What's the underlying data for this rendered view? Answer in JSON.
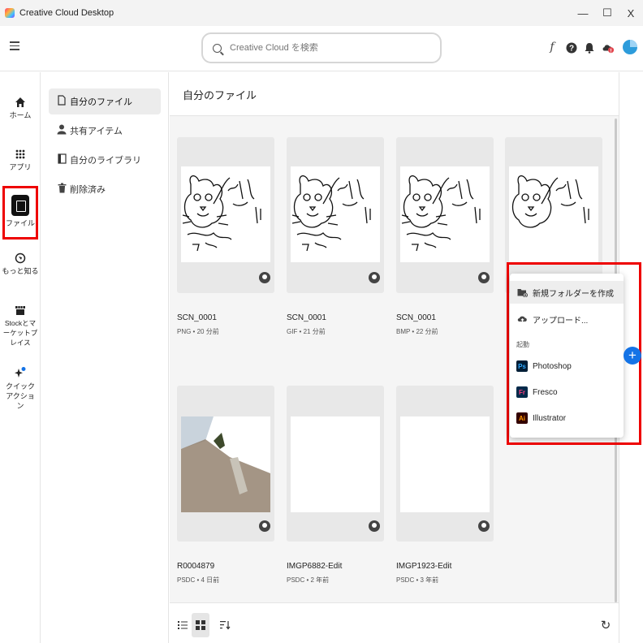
{
  "window": {
    "title": "Creative Cloud Desktop",
    "minimize": "—",
    "maximize": "☐",
    "close": "X"
  },
  "header": {
    "search_placeholder": "Creative Cloud を検索",
    "font_icon": "f",
    "help_icon": "?",
    "bell_icon": "♪",
    "cloud_alert": "!"
  },
  "rail": {
    "items": [
      {
        "label": "ホーム",
        "icon": "home-icon",
        "glyph": "⌂"
      },
      {
        "label": "アプリ",
        "icon": "apps-grid-icon",
        "glyph": "∷"
      },
      {
        "label": "ファイル",
        "icon": "files-icon",
        "active": true
      },
      {
        "label": "もっと知る",
        "icon": "discover-icon",
        "glyph": "◎"
      },
      {
        "label": "Stockとマーケットプレイス",
        "icon": "stock-store-icon",
        "glyph": "☖"
      },
      {
        "label": "クイックアクション",
        "icon": "quick-actions-icon",
        "glyph": "✦"
      }
    ]
  },
  "subnav": {
    "items": [
      {
        "label": "自分のファイル",
        "glyph": "☐"
      },
      {
        "label": "共有アイテム",
        "glyph": "⚇"
      },
      {
        "label": "自分のライブラリ",
        "glyph": "▢"
      },
      {
        "label": "削除済み",
        "glyph": "⌨"
      }
    ]
  },
  "main": {
    "title": "自分のファイル",
    "files": [
      {
        "name": "SCN_0001",
        "meta": "PNG • 20 分前"
      },
      {
        "name": "SCN_0001",
        "meta": "GIF • 21 分前"
      },
      {
        "name": "SCN_0001",
        "meta": "BMP • 22 分前"
      },
      {
        "name": "",
        "meta": ""
      },
      {
        "name": "R0004879",
        "meta": "PSDC • 4 日前"
      },
      {
        "name": "IMGP6882-Edit",
        "meta": "PSDC • 2 年前"
      },
      {
        "name": "IMGP1923-Edit",
        "meta": "PSDC • 3 年前"
      }
    ]
  },
  "bottombar": {
    "list_view": "☰",
    "grid_view": "▦",
    "sort": "⇅",
    "refresh": "↻"
  },
  "menu": {
    "new_folder": "新規フォルダーを作成",
    "upload": "アップロード...",
    "launch_section": "起動",
    "apps": [
      {
        "label": "Photoshop",
        "abbr": "Ps",
        "color": "#31a8ff",
        "bg": "#001e36"
      },
      {
        "label": "Fresco",
        "abbr": "Fr",
        "color": "#ff3d7f",
        "bg": "#002a4a"
      },
      {
        "label": "Illustrator",
        "abbr": "Ai",
        "color": "#ff9a00",
        "bg": "#330000"
      }
    ]
  },
  "fab": {
    "label": "+"
  },
  "colors": {
    "accent": "#1473e6",
    "highlight_border": "#e00000"
  }
}
